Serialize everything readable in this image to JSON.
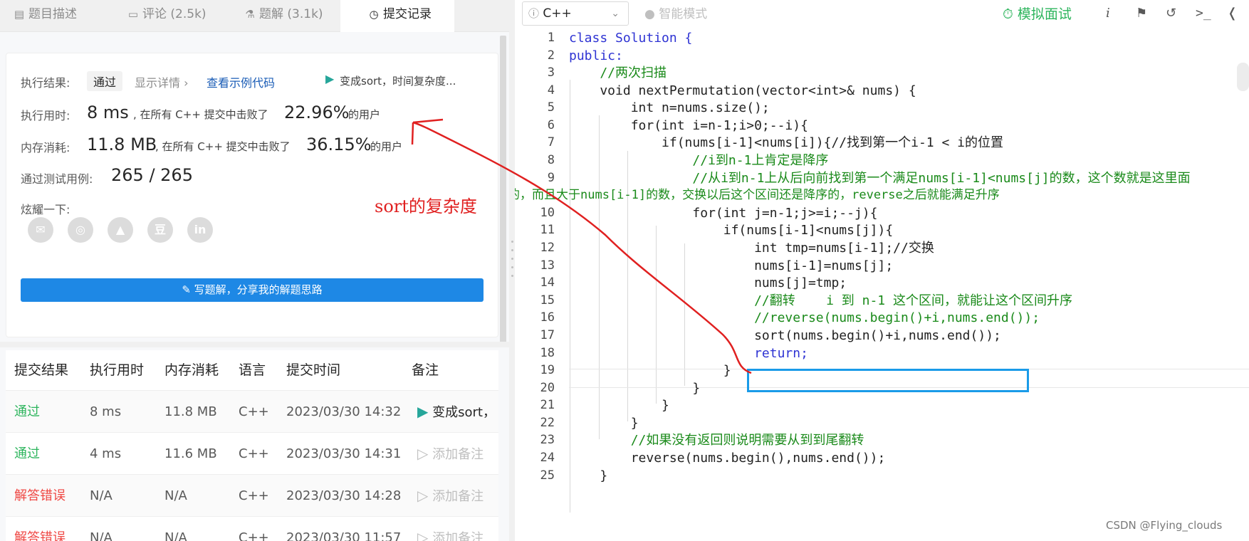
{
  "tabs": [
    {
      "icon": "▤",
      "label": "题目描述"
    },
    {
      "icon": "▭",
      "label": "评论 (2.5k)"
    },
    {
      "icon": "⚗",
      "label": "题解 (3.1k)"
    },
    {
      "icon": "◷",
      "label": "提交记录"
    }
  ],
  "result": {
    "status_label": "执行结果:",
    "status_value": "通过",
    "detail_link": "显示详情 ›",
    "sample_link": "查看示例代码",
    "note": "变成sort，时间复杂度...",
    "time_label": "执行用时:",
    "time_value": "8 ms",
    "time_beat_text": ", 在所有 C++ 提交中击败了",
    "time_pct": "22.96%",
    "users": "的用户",
    "mem_label": "内存消耗:",
    "mem_value": "11.8 MB",
    "mem_beat_text": ", 在所有 C++ 提交中击败了",
    "mem_pct": "36.15%",
    "tests_label": "通过测试用例:",
    "tests_value": "265 / 265",
    "share_label": "炫耀一下:",
    "share_icons": [
      "wechat-icon",
      "weibo-icon",
      "qq-icon",
      "douban-icon",
      "linkedin-icon"
    ],
    "share_glyphs": [
      "✉",
      "◎",
      "▲",
      "豆",
      "in"
    ],
    "write_button": "写题解，分享我的解题思路"
  },
  "table": {
    "headers": [
      "提交结果",
      "执行用时",
      "内存消耗",
      "语言",
      "提交时间",
      "备注"
    ],
    "rows": [
      {
        "result": "通过",
        "time": "8 ms",
        "mem": "11.8 MB",
        "lang": "C++",
        "date": "2023/03/30 14:32",
        "note": "变成sort，"
      },
      {
        "result": "通过",
        "time": "4 ms",
        "mem": "11.6 MB",
        "lang": "C++",
        "date": "2023/03/30 14:31",
        "note": "添加备注"
      },
      {
        "result": "解答错误",
        "time": "N/A",
        "mem": "N/A",
        "lang": "C++",
        "date": "2023/03/30 14:28",
        "note": "添加备注"
      },
      {
        "result": "解答错误",
        "time": "N/A",
        "mem": "N/A",
        "lang": "C++",
        "date": "2023/03/30 11:57",
        "note": "添加备注"
      }
    ]
  },
  "editor_toolbar": {
    "language": "C++",
    "smart_mode": "智能模式",
    "mock_interview": "模拟面试"
  },
  "code_lines": [
    {
      "n": "1",
      "text": "class Solution {"
    },
    {
      "n": "2",
      "text": "public:"
    },
    {
      "n": "3",
      "text": "    //两次扫描"
    },
    {
      "n": "4",
      "text": "    void nextPermutation(vector<int>& nums) {"
    },
    {
      "n": "5",
      "text": "        int n=nums.size();"
    },
    {
      "n": "6",
      "text": "        for(int i=n-1;i>0;--i){"
    },
    {
      "n": "7",
      "text": "            if(nums[i-1]<nums[i]){//找到第一个i-1 < i的位置"
    },
    {
      "n": "8",
      "text": "                //i到n-1上肯定是降序"
    },
    {
      "n": "9",
      "text": "                //从i到n-1上从后向前找到第一个满足nums[i-1]<nums[j]的数，这个数就是这里面"
    },
    {
      "n": "",
      "text": "的，而且大于nums[i-1]的数，交换以后这个区间还是降序的，reverse之后就能满足升序"
    },
    {
      "n": "10",
      "text": "                for(int j=n-1;j>=i;--j){"
    },
    {
      "n": "11",
      "text": "                    if(nums[i-1]<nums[j]){"
    },
    {
      "n": "12",
      "text": "                        int tmp=nums[i-1];//交换"
    },
    {
      "n": "13",
      "text": "                        nums[i-1]=nums[j];"
    },
    {
      "n": "14",
      "text": "                        nums[j]=tmp;"
    },
    {
      "n": "15",
      "text": "                        //翻转    i 到 n-1 这个区间，就能让这个区间升序"
    },
    {
      "n": "16",
      "text": "                        //reverse(nums.begin()+i,nums.end());"
    },
    {
      "n": "17",
      "text": "                        sort(nums.begin()+i,nums.end());"
    },
    {
      "n": "18",
      "text": "                        return;"
    },
    {
      "n": "19",
      "text": "                    }"
    },
    {
      "n": "20",
      "text": "                }"
    },
    {
      "n": "21",
      "text": "            }"
    },
    {
      "n": "22",
      "text": "        }"
    },
    {
      "n": "23",
      "text": "        //如果没有返回则说明需要从到到尾翻转"
    },
    {
      "n": "24",
      "text": "        reverse(nums.begin(),nums.end());"
    },
    {
      "n": "25",
      "text": "    }"
    }
  ],
  "annotation": {
    "label": "sort的复杂度"
  },
  "watermark": "CSDN @Flying_clouds",
  "colors": {
    "pass": "#2db55d",
    "fail": "#ef4743",
    "accent_blue": "#1e88e5",
    "annotation_red": "#e02020",
    "highlight_box": "#1a9be8"
  }
}
